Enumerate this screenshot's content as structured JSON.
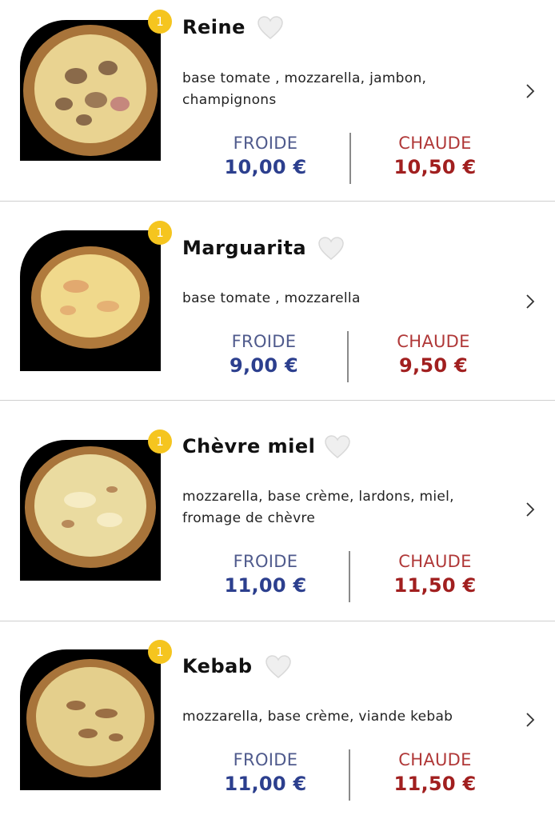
{
  "items": [
    {
      "badge": "1",
      "name": "Reine",
      "description": "base tomate , mozzarella, jambon, champignons",
      "cold_label": "FROIDE",
      "cold_price": "10,00 €",
      "hot_label": "CHAUDE",
      "hot_price": "10,50 €"
    },
    {
      "badge": "1",
      "name": "Marguarita",
      "description": "base tomate , mozzarella",
      "cold_label": "FROIDE",
      "cold_price": "9,00 €",
      "hot_label": "CHAUDE",
      "hot_price": "9,50 €"
    },
    {
      "badge": "1",
      "name": "Chèvre miel",
      "description": "mozzarella, base crème, lardons, miel, fromage de chèvre",
      "cold_label": "FROIDE",
      "cold_price": "11,00 €",
      "hot_label": "CHAUDE",
      "hot_price": "11,50 €"
    },
    {
      "badge": "1",
      "name": "Kebab",
      "description": "mozzarella, base crème, viande kebab",
      "cold_label": "FROIDE",
      "cold_price": "11,00 €",
      "hot_label": "CHAUDE",
      "hot_price": "11,50 €"
    }
  ],
  "colors": {
    "cold": "#2c3f8e",
    "hot": "#a11f1f",
    "badge": "#f5c51f"
  },
  "icons": {
    "favorite": "heart-icon",
    "open": "chevron-right-icon"
  }
}
